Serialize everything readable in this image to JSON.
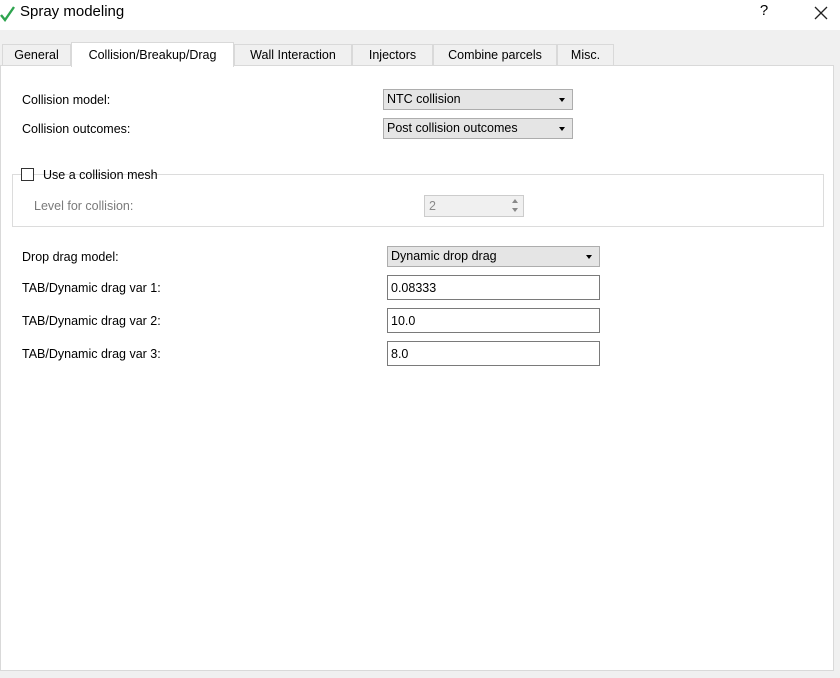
{
  "window": {
    "title": "Spray modeling",
    "help_label": "?",
    "check_icon": "check-icon",
    "close_icon": "close-icon",
    "accent": "#2ea44f"
  },
  "tabs": [
    {
      "label": "General"
    },
    {
      "label": "Collision/Breakup/Drag",
      "active": true
    },
    {
      "label": "Wall Interaction"
    },
    {
      "label": "Injectors"
    },
    {
      "label": "Combine parcels"
    },
    {
      "label": "Misc."
    }
  ],
  "collision": {
    "model_label": "Collision model:",
    "model_value": "NTC collision",
    "outcomes_label": "Collision outcomes:",
    "outcomes_value": "Post collision outcomes"
  },
  "collision_mesh": {
    "checkbox_label": "Use a collision mesh",
    "checked": false,
    "level_label": "Level for collision:",
    "level_value": "2"
  },
  "drag": {
    "model_label": "Drop drag model:",
    "model_value": "Dynamic drop drag",
    "var1_label": "TAB/Dynamic drag var 1:",
    "var1_value": "0.08333",
    "var2_label": "TAB/Dynamic drag var 2:",
    "var2_value": "10.0",
    "var3_label": "TAB/Dynamic drag var 3:",
    "var3_value": "8.0"
  }
}
